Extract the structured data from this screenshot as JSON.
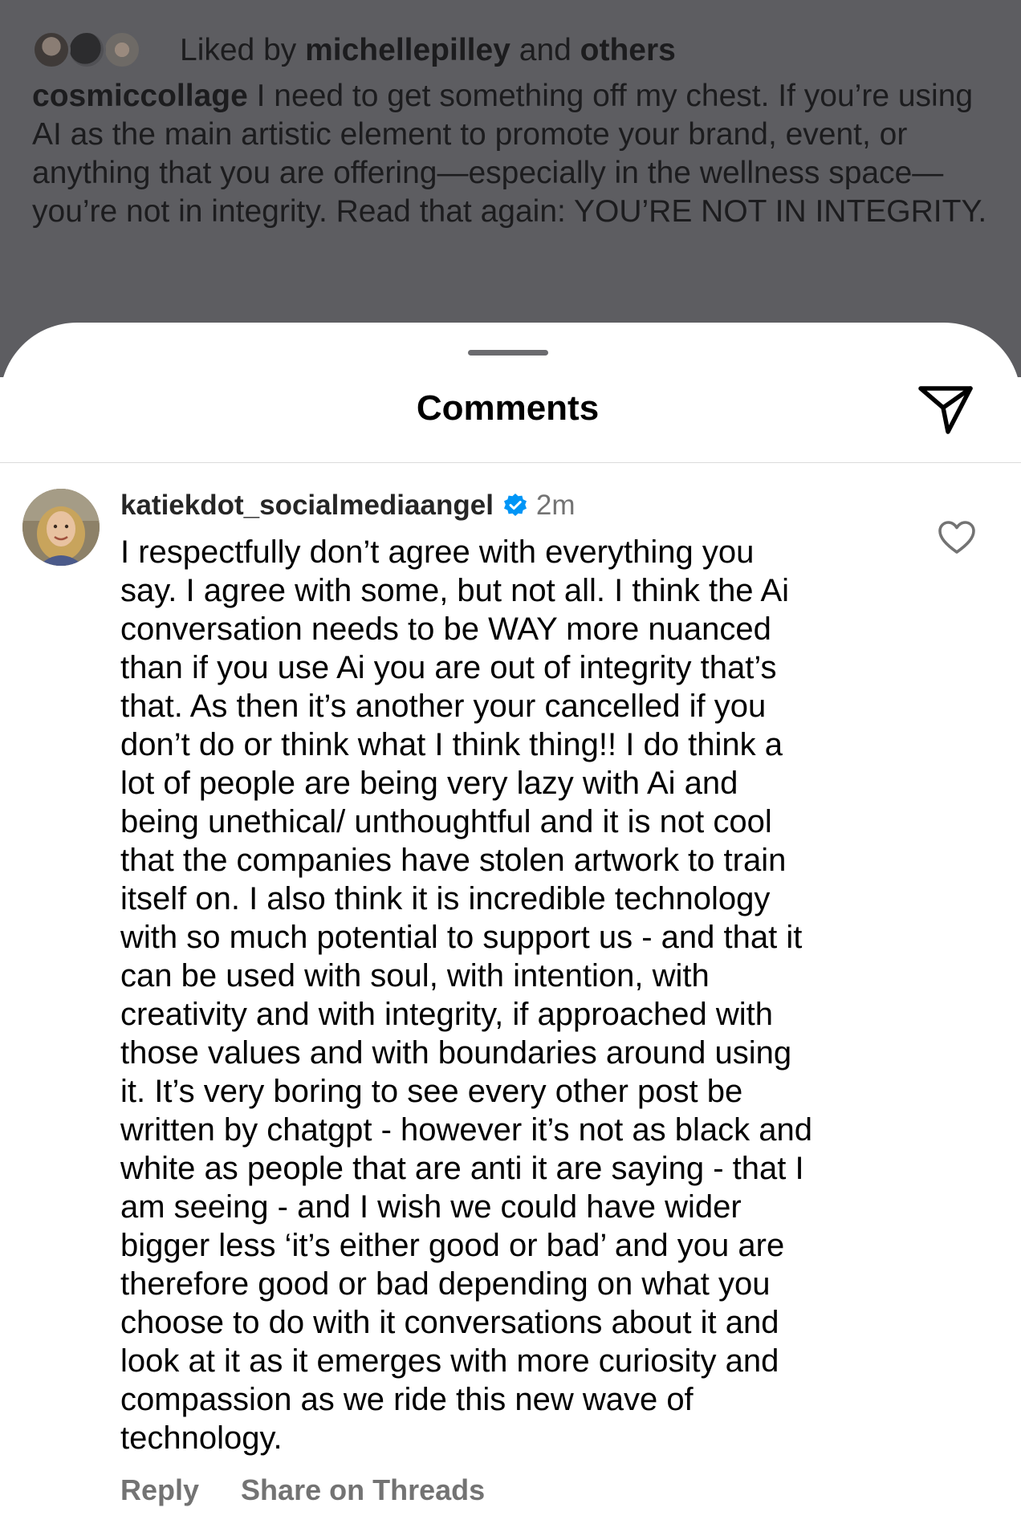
{
  "post": {
    "liked_prefix": "Liked by",
    "liked_user": "michellepilley",
    "liked_and": "and",
    "liked_others": "others",
    "author": "cosmiccollage",
    "caption": "I need to get something off my chest. If you’re using AI as the main artistic element to promote your brand, event, or anything that you are offering—especially in the wellness space—you’re not in integrity. Read that again: YOU’RE NOT IN INTEGRITY."
  },
  "sheet": {
    "title": "Comments"
  },
  "comment": {
    "username": "katiekdot_socialmediaangel",
    "time": "2m",
    "text": "I respectfully don’t agree with everything you\nsay. I agree with some, but not all.  I think the Ai\nconversation needs to be WAY more nuanced\nthan if you use Ai you are out of integrity that’s\nthat. As then it’s another your cancelled if you\ndon’t do or think what I think thing!! I do think a\nlot of people are being very lazy with Ai and\nbeing unethical/ unthoughtful and it is not cool\nthat the companies have stolen artwork to train\nitself on. I also think it is incredible technology\nwith so much potential to support us - and that it\ncan be used with soul, with intention, with\ncreativity and with integrity, if approached with\nthose values and with boundaries around using\nit. It’s very boring to see every other post be\nwritten by chatgpt - however it’s not as black and\nwhite as people that are anti it are saying - that I\nam seeing - and I wish we could have wider\nbigger less ‘it’s either good or bad’ and you are\ntherefore good or bad depending on what you\nchoose to do with it conversations about it and\nlook at it as it emerges with more curiosity and\ncompassion as we ride this new wave of\ntechnology.",
    "reply_label": "Reply",
    "share_threads_label": "Share on Threads"
  },
  "icons": {
    "share": "paper-plane-icon",
    "verified": "verified-badge-icon",
    "like": "heart-icon"
  },
  "colors": {
    "dim_overlay": "#5d5d61",
    "verified_blue": "#0095f6",
    "secondary_text": "#737373"
  }
}
